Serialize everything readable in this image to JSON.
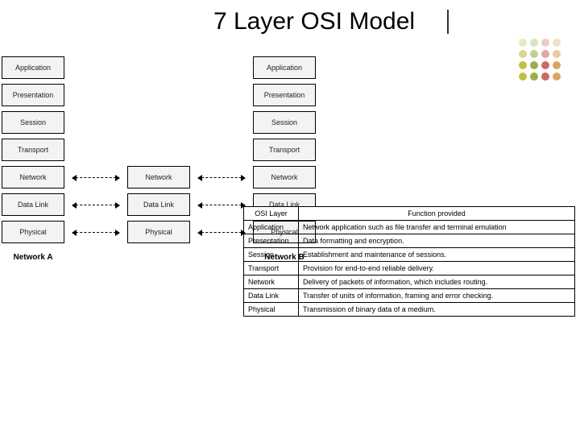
{
  "title": "7 Layer OSI Model",
  "decor": {
    "dot_colors": [
      "#c0c040",
      "#98b050",
      "#d06868",
      "#d8a860"
    ]
  },
  "diagram": {
    "layers": [
      "Application",
      "Presentation",
      "Session",
      "Transport",
      "Network",
      "Data Link",
      "Physical"
    ],
    "middle_start_index": 4,
    "labelA": "Network A",
    "labelB": "Network B"
  },
  "table": {
    "header_layer": "OSI Layer",
    "header_func": "Function provided",
    "rows": [
      {
        "layer": "Application",
        "func": "Network application such as file transfer and terminal emulation"
      },
      {
        "layer": "Presentation",
        "func": "Data formatting and encryption."
      },
      {
        "layer": "Session",
        "func": "Establishment and maintenance of sessions."
      },
      {
        "layer": "Transport",
        "func": "Provision for end-to-end reliable delivery."
      },
      {
        "layer": "Network",
        "func": "Delivery of packets of information, which includes routing."
      },
      {
        "layer": "Data Link",
        "func": "Transfer of units of information, framing and error checking."
      },
      {
        "layer": "Physical",
        "func": "Transmission of binary data of a medium."
      }
    ]
  }
}
